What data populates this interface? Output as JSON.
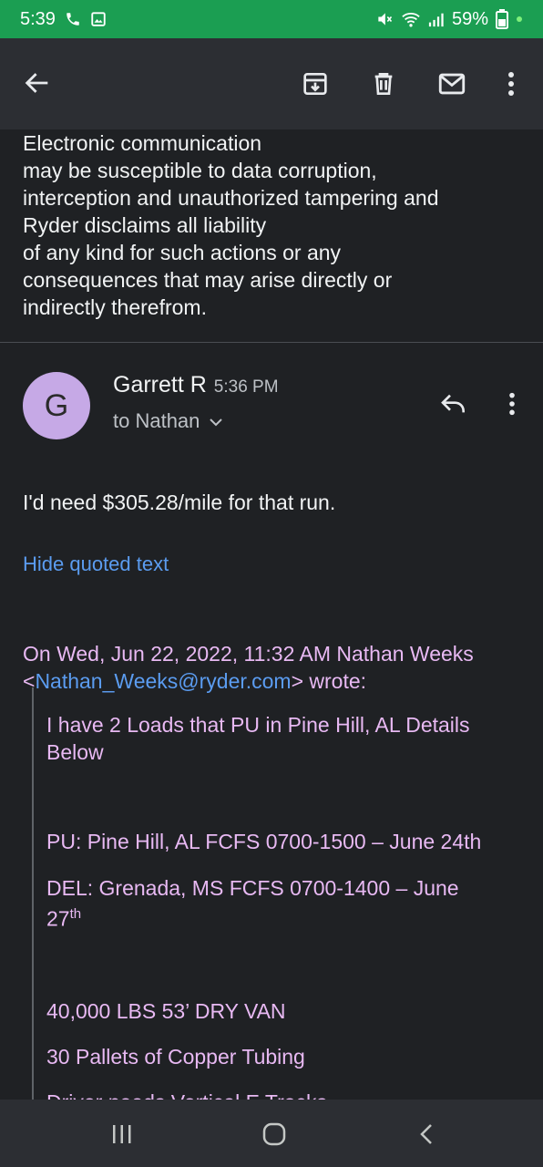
{
  "status_bar": {
    "time": "5:39",
    "battery": "59%",
    "icons": [
      "phone-icon",
      "image-icon",
      "mute-icon",
      "wifi-icon",
      "signal-icon",
      "battery-icon"
    ]
  },
  "toolbar": {
    "icons": [
      "back-arrow-icon",
      "archive-icon",
      "trash-icon",
      "mail-icon",
      "more-vert-icon"
    ]
  },
  "disclaimer": {
    "lines": [
      "Electronic communication",
      "may be susceptible to data corruption,",
      "interception and unauthorized tampering and",
      "Ryder disclaims all liability",
      "of any kind for such actions or any",
      "consequences that may arise directly or",
      "indirectly therefrom."
    ]
  },
  "message": {
    "avatar_letter": "G",
    "sender": "Garrett R",
    "time": "5:36 PM",
    "recipient": "to Nathan",
    "body": "I'd need $305.28/mile for that run.",
    "hide_quoted": "Hide quoted text"
  },
  "quote": {
    "header_line1": "On Wed, Jun 22, 2022, 11:32 AM Nathan Weeks",
    "header_open": "<",
    "header_email": "Nathan_Weeks@ryder.com",
    "header_close": "> wrote:",
    "line1": "I have 2 Loads that PU in Pine Hill, AL Details",
    "line2": "Below",
    "pu": "PU: Pine Hill, AL FCFS 0700-1500 – June 24th",
    "del": "DEL: Grenada, MS FCFS 0700-1400 – June",
    "del_day": "27",
    "del_sup": "th",
    "weight": "40,000 LBS 53’ DRY VAN",
    "pallets": "30 Pallets of Copper Tubing",
    "driver": "Driver needs Vertical E Tracks"
  },
  "colors": {
    "status_bar": "#1b9e52",
    "background": "#1f2124",
    "app_bar": "#2c2e33",
    "quote_text": "#e8b9f3",
    "link": "#5b9cf0",
    "avatar": "#c6a9e6"
  }
}
